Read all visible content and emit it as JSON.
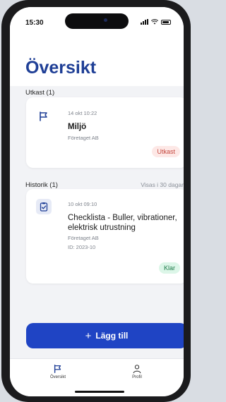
{
  "status": {
    "time": "15:30"
  },
  "header": {
    "title": "Översikt"
  },
  "drafts": {
    "label": "Utkast (1)",
    "items": [
      {
        "timestamp": "14 okt 10:22",
        "title": "Miljö",
        "company": "Företaget AB",
        "badge": "Utkast",
        "icon": "flag-icon"
      }
    ]
  },
  "history": {
    "label": "Historik (1)",
    "hint": "Visas i 30 dagar",
    "items": [
      {
        "timestamp": "10 okt 09:10",
        "title_line1": "Checklista - Buller, vibrationer,",
        "title_line2": "elektrisk utrustning",
        "company": "Företaget AB",
        "id": "ID: 2023-10",
        "badge": "Klar",
        "icon": "clipboard-icon"
      }
    ]
  },
  "actions": {
    "add_label": "Lägg till",
    "add_icon": "plus-icon"
  },
  "tabbar": {
    "tabs": [
      {
        "label": "Översikt",
        "icon": "flag-icon"
      },
      {
        "label": "Profil",
        "icon": "person-icon"
      }
    ]
  },
  "colors": {
    "accent": "#1f44c4",
    "title": "#1f3f96",
    "draft_badge": "#fde8e6",
    "done_badge": "#dcf6e8"
  }
}
